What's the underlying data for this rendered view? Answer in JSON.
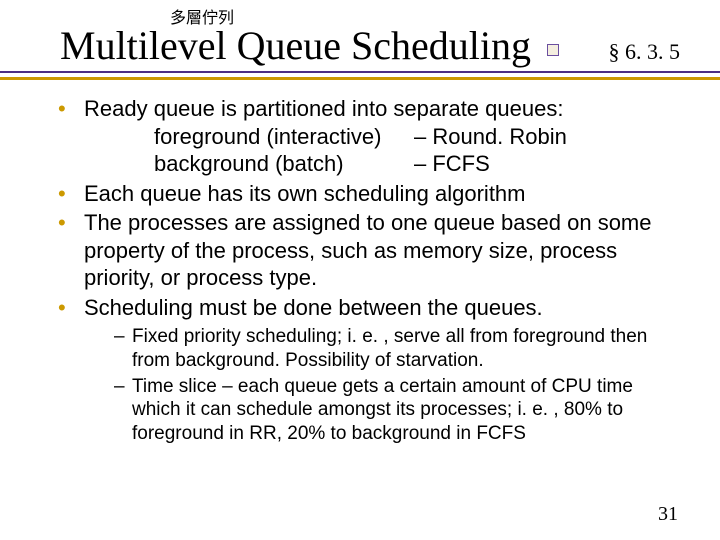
{
  "header": {
    "cjk": "多層佇列",
    "title": "Multilevel Queue Scheduling",
    "section_ref": "§ 6. 3. 5"
  },
  "bullets": [
    {
      "text": "Ready queue is partitioned into separate queues:",
      "indent_rows": [
        {
          "col1": "foreground (interactive)",
          "col2": "– Round. Robin"
        },
        {
          "col1": "background (batch)",
          "col2": "– FCFS"
        }
      ]
    },
    {
      "text": "Each queue has its own scheduling algorithm"
    },
    {
      "text": "The processes are assigned to one queue based on some property of the process, such as memory size, process priority, or process type."
    },
    {
      "text": "Scheduling must be done between the queues."
    }
  ],
  "subs": [
    "Fixed priority scheduling; i. e. , serve all from foreground then from background.  Possibility of starvation.",
    "Time slice – each queue gets a certain amount of CPU time which it can schedule amongst its processes; i. e. , 80% to foreground in RR, 20% to background in FCFS"
  ],
  "page_number": "31"
}
